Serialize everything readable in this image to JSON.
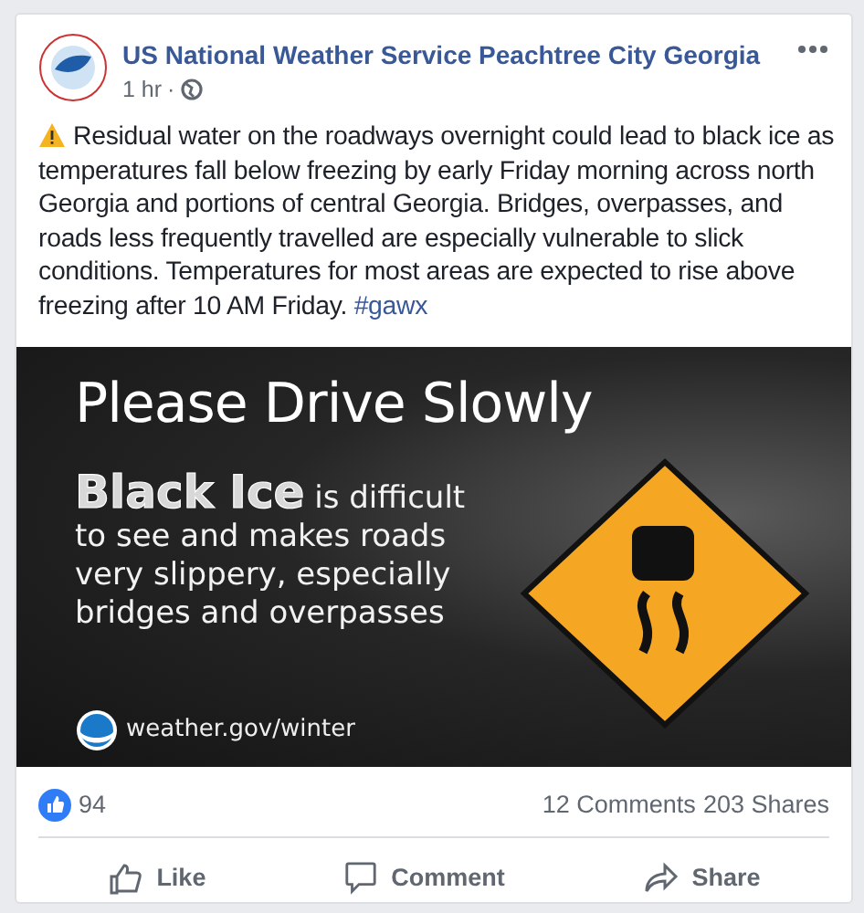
{
  "post": {
    "author": "US National Weather Service Peachtree City Georgia",
    "time": "1 hr",
    "separator": "·",
    "body": "Residual water on the roadways overnight could lead to black ice as temperatures fall below freezing by early Friday morning across north Georgia and portions of central Georgia. Bridges, overpasses, and roads less frequently travelled are especially vulnerable to slick conditions. Temperatures for most areas are expected to rise above freezing after 10 AM Friday.",
    "hashtag": "#gawx"
  },
  "graphic": {
    "headline": "Please Drive Slowly",
    "message": "**Black Ice** is difficult to see and makes roads very slippery, especially bridges and overpasses",
    "url": "weather.gov/winter"
  },
  "stats": {
    "reactions": "94",
    "comments": "12 Comments",
    "shares": "203 Shares"
  },
  "actions": [
    {
      "kind": "like",
      "label": "Like"
    },
    {
      "kind": "comment",
      "label": "Comment"
    },
    {
      "kind": "share",
      "label": "Share"
    }
  ]
}
